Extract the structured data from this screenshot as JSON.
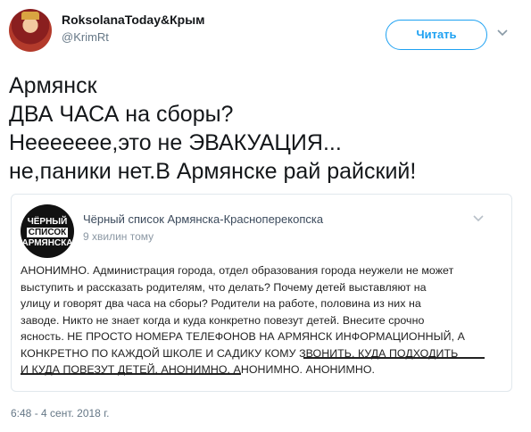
{
  "author": {
    "display_name": "RoksolanaToday&Крым",
    "handle": "@KrimRt",
    "follow_label": "Читать"
  },
  "tweet": {
    "lines": [
      "Армянск",
      "ДВА ЧАСА на сборы?",
      "Неееееее,это не ЭВАКУАЦИЯ...",
      "не,паники нет.В Армянске рай райский!"
    ],
    "timestamp": "6:48 - 4 сент. 2018 г."
  },
  "embedded_post": {
    "logo_text": [
      "ЧЁРНЫЙ",
      "СПИСОК",
      "АРМЯНСКА"
    ],
    "source_name": "Чёрный список Армянска-Красноперекопска",
    "time_ago": "9 хвилин тому",
    "body_lines": [
      "АНОНИМНО. Администрация города, отдел образования города неужели не может",
      "выступить и рассказать родителям, что делать? Почему детей выставляют на",
      "улицу и говорят два часа на сборы? Родители на работе, половина из них на",
      "заводе. Никто не знает когда и куда конкретно повезут детей. Внесите срочно",
      "ясность. НЕ ПРОСТО НОМЕРА ТЕЛЕФОНОВ НА АРМЯНСК ИНФОРМАЦИОННЫЙ, А",
      "КОНКРЕТНО ПО КАЖДОЙ ШКОЛЕ И САДИКУ КОМУ ЗВОНИТЬ, КУДА ПОДХОДИТЬ",
      "И КУДА ПОВЕЗУТ ДЕТЕЙ. АНОНИМНО. АНОНИМНО. АНОНИМНО."
    ]
  },
  "colors": {
    "accent": "#1da1f2",
    "text": "#14171a",
    "muted": "#657786"
  }
}
